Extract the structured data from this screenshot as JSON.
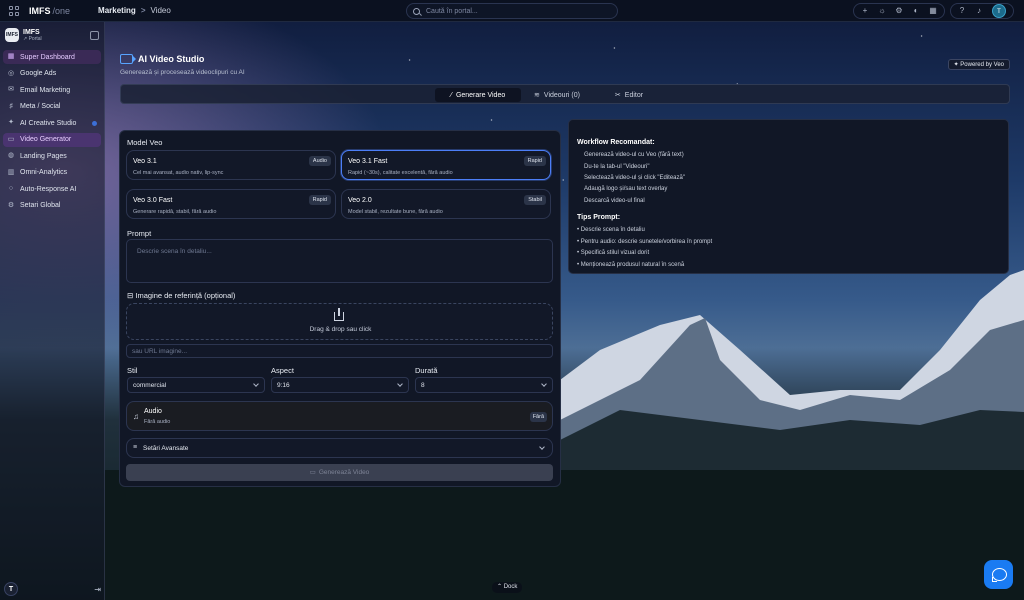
{
  "app": {
    "brand": "IMFS",
    "brand_suffix": "/one"
  },
  "breadcrumb": {
    "section": "Marketing",
    "separator": ">",
    "current": "Video"
  },
  "search": {
    "placeholder": "Caută în portal..."
  },
  "user": {
    "initial": "T"
  },
  "sidebar": {
    "org_name": "IMFS",
    "org_sub": "↗ Portal",
    "items": [
      {
        "label": "Super Dashboard",
        "icon": "dashboard-icon"
      },
      {
        "label": "Google Ads",
        "icon": "ads-icon"
      },
      {
        "label": "Email Marketing",
        "icon": "mail-icon"
      },
      {
        "label": "Meta / Social",
        "icon": "social-icon"
      },
      {
        "label": "AI Creative Studio",
        "icon": "sparkles-icon"
      },
      {
        "label": "Video Generator",
        "icon": "video-icon"
      },
      {
        "label": "Landing Pages",
        "icon": "globe-icon"
      },
      {
        "label": "Omni-Analytics",
        "icon": "analytics-icon"
      },
      {
        "label": "Auto-Response AI",
        "icon": "chat-icon"
      },
      {
        "label": "Setari Global",
        "icon": "gear-icon"
      }
    ],
    "footer_initial": "T"
  },
  "header": {
    "title": "AI Video Studio",
    "subtitle": "Generează și procesează videoclipuri cu AI",
    "powered": "Powered by Veo"
  },
  "tabs": [
    {
      "label": "Generare Video",
      "icon": "wand-icon"
    },
    {
      "label": "Videouri (0)",
      "icon": "layers-icon"
    },
    {
      "label": "Editor",
      "icon": "scissors-icon"
    }
  ],
  "form": {
    "model_label": "Model Veo",
    "models": [
      {
        "name": "Veo 3.1",
        "desc": "Cel mai avansat, audio nativ, lip-sync",
        "badge": "Audio"
      },
      {
        "name": "Veo 3.1 Fast",
        "desc": "Rapid (~30s), calitate excelentă, fără audio",
        "badge": "Rapid"
      },
      {
        "name": "Veo 3.0 Fast",
        "desc": "Generare rapidă, stabil, fără audio",
        "badge": "Rapid"
      },
      {
        "name": "Veo 2.0",
        "desc": "Model stabil, rezultate bune, fără audio",
        "badge": "Stabil"
      }
    ],
    "selected_model": "Veo 3.1 Fast",
    "prompt_label": "Prompt",
    "prompt_placeholder": "Descrie scena în detaliu...",
    "ref_label": "Imagine de referință (opțional)",
    "drop_text": "Drag & drop sau click",
    "url_placeholder": "sau URL imagine...",
    "style_label": "Stil",
    "style_value": "commercial",
    "aspect_label": "Aspect",
    "aspect_value": "9:16",
    "duration_label": "Durată",
    "duration_value": "8",
    "audio_title": "Audio",
    "audio_sub": "Fără audio",
    "audio_badge": "Fără",
    "advanced": "Setări Avansate",
    "generate": "Generează Video"
  },
  "workflow": {
    "title": "Workflow Recomandat:",
    "steps": [
      "Generează video-ul cu Veo (fără text)",
      "Du-te la tab-ul \"Videouri\"",
      "Selectează video-ul și click \"Editează\"",
      "Adaugă logo și/sau text overlay",
      "Descarcă video-ul final"
    ],
    "tips_title": "Tips Prompt:",
    "tips": [
      "• Descrie scena în detaliu",
      "• Pentru audio: descrie sunetele/vorbirea în prompt",
      "• Specifică stilul vizual dorit",
      "• Menționează produsul natural în scenă"
    ]
  },
  "dock": "⌃ Dock"
}
